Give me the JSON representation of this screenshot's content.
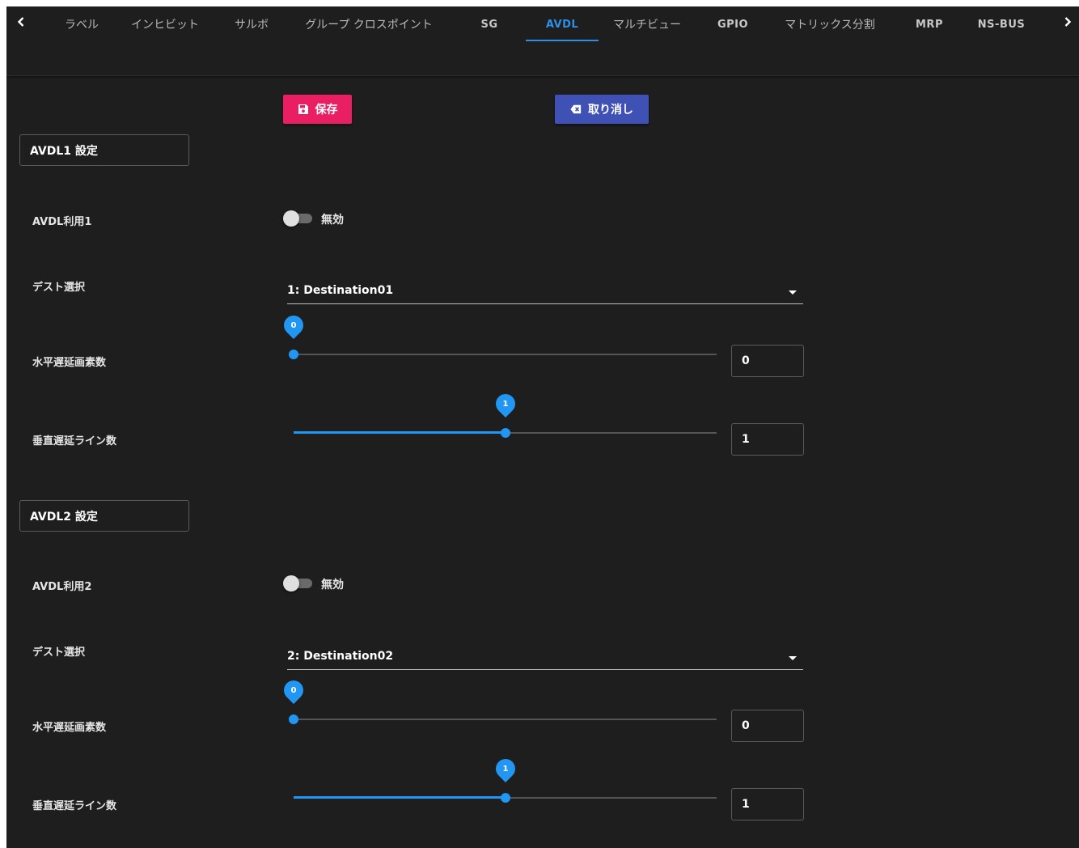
{
  "colors": {
    "background": "#1e1e1e",
    "accent": "#2d8fe6",
    "save_button": "#e91e63",
    "cancel_button": "#3f51b5",
    "slider": "#2196f3"
  },
  "tabs": [
    {
      "label": "ラベル",
      "active": false
    },
    {
      "label": "インヒビット",
      "active": false
    },
    {
      "label": "サルボ",
      "active": false
    },
    {
      "label": "グループ クロスポイント",
      "active": false
    },
    {
      "label": "SG",
      "active": false
    },
    {
      "label": "AVDL",
      "active": true
    },
    {
      "label": "マルチビュー",
      "active": false
    },
    {
      "label": "GPIO",
      "active": false
    },
    {
      "label": "マトリックス分割",
      "active": false
    },
    {
      "label": "MRP",
      "active": false
    },
    {
      "label": "NS-BUS",
      "active": false
    }
  ],
  "tab_nav": {
    "prev_icon": "chevron-left-icon",
    "next_icon": "chevron-right-icon"
  },
  "actions": {
    "save_label": "保存",
    "save_icon": "floppy-disk-icon",
    "cancel_label": "取り消し",
    "cancel_icon": "backspace-icon"
  },
  "sections": [
    {
      "title": "AVDL1 設定",
      "enable_label": "AVDL利用1",
      "enable_state_text": "無効",
      "enabled": false,
      "dest_label": "デスト選択",
      "dest_value": "1: Destination01",
      "h_delay_label": "水平遅延画素数",
      "h_delay_value": "0",
      "h_delay_fraction": 0.0,
      "v_delay_label": "垂直遅延ライン数",
      "v_delay_value": "1",
      "v_delay_fraction": 0.5
    },
    {
      "title": "AVDL2 設定",
      "enable_label": "AVDL利用2",
      "enable_state_text": "無効",
      "enabled": false,
      "dest_label": "デスト選択",
      "dest_value": "2: Destination02",
      "h_delay_label": "水平遅延画素数",
      "h_delay_value": "0",
      "h_delay_fraction": 0.0,
      "v_delay_label": "垂直遅延ライン数",
      "v_delay_value": "1",
      "v_delay_fraction": 0.5
    }
  ]
}
